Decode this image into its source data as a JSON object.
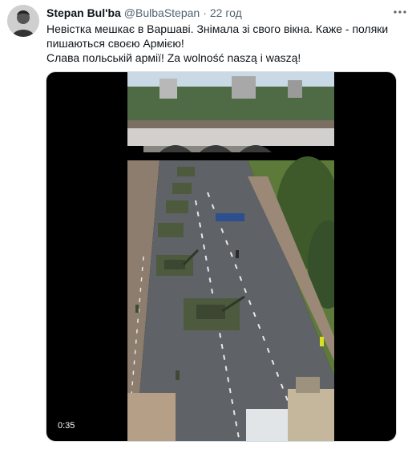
{
  "tweet": {
    "author_name": "Stepan Bul'ba",
    "author_handle": "@BulbaStepan",
    "separator": "·",
    "time": "22 год",
    "text_line1": "Невістка мешкає в Варшаві. Знімала зі свого вікна. Каже - поляки пишаються своєю Армією!",
    "text_line2": "Слава польській армії! Za wolność naszą i waszą!",
    "video": {
      "duration": "0:35",
      "content": "military parade"
    }
  },
  "colors": {
    "text": "#0f1419",
    "secondary": "#536471",
    "border": "#cfd9de",
    "video_bg": "#000000"
  },
  "icons": {
    "avatar": "user-avatar",
    "more": "more-dots-icon"
  }
}
